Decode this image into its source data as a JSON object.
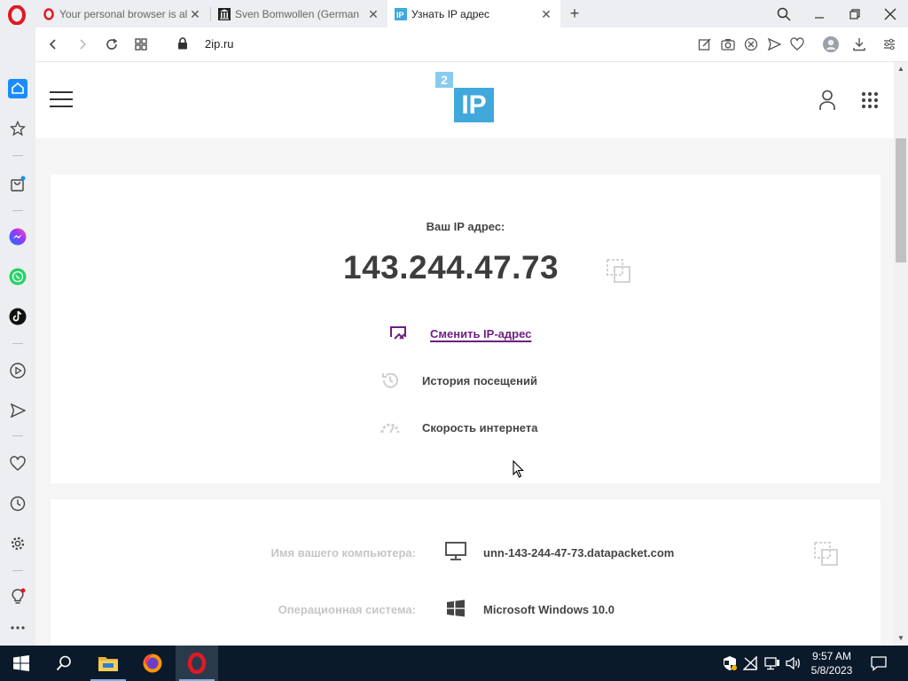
{
  "browser": {
    "tabs": [
      {
        "title": "Your personal browser is al",
        "active": false
      },
      {
        "title": "Sven Bomwollen (German",
        "active": false
      },
      {
        "title": "Узнать IP адрес",
        "active": true
      }
    ],
    "url": "2ip.ru"
  },
  "site": {
    "logo": {
      "badge": "2",
      "text": "IP"
    }
  },
  "main": {
    "ip_label": "Ваш IP адрес:",
    "ip_value": "143.244.47.73",
    "actions": [
      {
        "label": "Сменить IP-адрес"
      },
      {
        "label": "История посещений"
      },
      {
        "label": "Скорость интернета"
      }
    ]
  },
  "info": {
    "rows": [
      {
        "label": "Имя вашего компьютера:",
        "value": "unn-143-244-47-73.datapacket.com",
        "icon": "monitor-icon"
      },
      {
        "label": "Операционная система:",
        "value": "Microsoft Windows 10.0",
        "icon": "windows-icon"
      }
    ]
  },
  "taskbar": {
    "time": "9:57 AM",
    "date": "5/8/2023"
  },
  "colors": {
    "link": "#6d1f7e",
    "logo_blue": "#41a8dc",
    "opera_red": "#e11923",
    "taskbar": "#0b1a2b"
  }
}
